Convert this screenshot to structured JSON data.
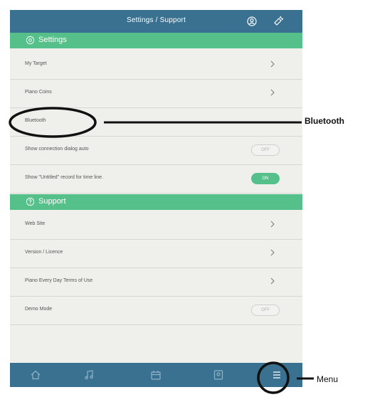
{
  "header": {
    "title": "Settings / Support",
    "account_icon": "account-icon",
    "link_icon": "usb-link-icon"
  },
  "sections": {
    "settings": {
      "label": "Settings",
      "icon": "gear-icon"
    },
    "support": {
      "label": "Support",
      "icon": "question-icon"
    }
  },
  "settings_rows": [
    {
      "label": "My Target",
      "control": "chevron"
    },
    {
      "label": "Piano Coins",
      "control": "chevron"
    },
    {
      "label": "Bluetooth",
      "control": "chevron"
    },
    {
      "label": "Show connection dialog auto",
      "control": "toggle",
      "toggle_text": "OFF",
      "state": "off"
    },
    {
      "label": "Show \"Untitled\" record for time line.",
      "control": "toggle",
      "toggle_text": "ON",
      "state": "on"
    }
  ],
  "support_rows": [
    {
      "label": "Web Site",
      "control": "chevron"
    },
    {
      "label": "Version / Licence",
      "control": "chevron"
    },
    {
      "label": "Piano Every Day Terms of Use",
      "control": "chevron"
    },
    {
      "label": "Demo Mode",
      "control": "toggle",
      "toggle_text": "OFF",
      "state": "off"
    }
  ],
  "tabbar": {
    "tabs": [
      "home-icon",
      "music-note-icon",
      "calendar-icon",
      "diary-icon",
      "menu-icon"
    ]
  },
  "callouts": {
    "bluetooth": "Bluetooth",
    "menu": "Menu"
  },
  "colors": {
    "header": "#3a7090",
    "section": "#56c08a",
    "background": "#efefec",
    "toggle_on": "#56c08a"
  }
}
